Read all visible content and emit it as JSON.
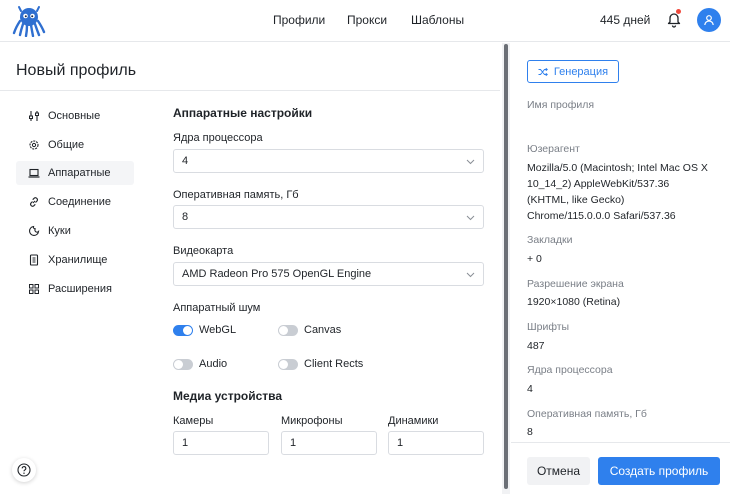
{
  "header": {
    "nav": [
      "Профили",
      "Прокси",
      "Шаблоны"
    ],
    "days_left": "445 дней"
  },
  "page": {
    "title": "Новый профиль"
  },
  "sidebar": {
    "items": [
      {
        "label": "Основные",
        "icon": "sliders-icon"
      },
      {
        "label": "Общие",
        "icon": "gear-icon"
      },
      {
        "label": "Аппаратные",
        "icon": "laptop-icon",
        "active": true
      },
      {
        "label": "Соединение",
        "icon": "link-icon"
      },
      {
        "label": "Куки",
        "icon": "cookie-icon"
      },
      {
        "label": "Хранилище",
        "icon": "storage-icon"
      },
      {
        "label": "Расширения",
        "icon": "grid-icon"
      }
    ]
  },
  "hardware": {
    "section_title": "Аппаратные настройки",
    "cpu_label": "Ядра процессора",
    "cpu_value": "4",
    "ram_label": "Оперативная память, Гб",
    "ram_value": "8",
    "gpu_label": "Видеокарта",
    "gpu_value": "AMD Radeon Pro 575 OpenGL Engine",
    "noise_label": "Аппаратный шум",
    "noise_toggles": [
      {
        "label": "WebGL",
        "on": true
      },
      {
        "label": "Canvas",
        "on": false
      },
      {
        "label": "Audio",
        "on": false
      },
      {
        "label": "Client Rects",
        "on": false
      }
    ]
  },
  "media": {
    "section_title": "Медиа устройства",
    "cameras_label": "Камеры",
    "cameras_value": "1",
    "mics_label": "Микрофоны",
    "mics_value": "1",
    "speakers_label": "Динамики",
    "speakers_value": "1"
  },
  "summary": {
    "generate_label": "Генерация",
    "profile_name_label": "Имя профиля",
    "useragent_label": "Юзерагент",
    "useragent_lines": [
      "Mozilla/5.0 (Macintosh; Intel Mac OS X",
      "10_14_2) AppleWebKit/537.36",
      "(KHTML, like Gecko)",
      "Chrome/115.0.0.0 Safari/537.36"
    ],
    "bookmarks_label": "Закладки",
    "bookmarks_value": "+ 0",
    "resolution_label": "Разрешение экрана",
    "resolution_value": "1920×1080 (Retina)",
    "fonts_label": "Шрифты",
    "fonts_value": "487",
    "cpu_label": "Ядра процессора",
    "cpu_value": "4",
    "ram_label": "Оперативная память, Гб",
    "ram_value": "8"
  },
  "footer": {
    "cancel_label": "Отмена",
    "create_label": "Создать профиль"
  },
  "colors": {
    "accent": "#2f80ed",
    "notification": "#f04a3e"
  }
}
